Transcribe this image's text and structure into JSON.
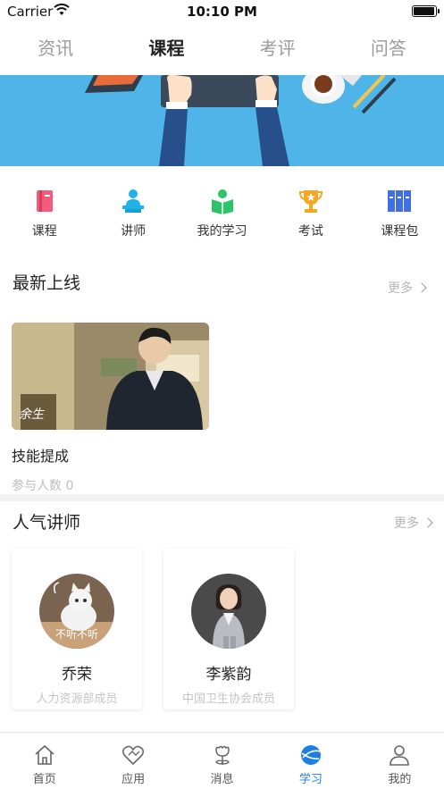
{
  "status_bar": {
    "carrier": "Carrier",
    "time": "10:10 PM"
  },
  "top_tabs": [
    {
      "label": "资讯",
      "active": false
    },
    {
      "label": "课程",
      "active": true
    },
    {
      "label": "考评",
      "active": false
    },
    {
      "label": "问答",
      "active": false
    }
  ],
  "quick_menu": [
    {
      "label": "课程",
      "icon": "book-icon",
      "color": "#f25c7a"
    },
    {
      "label": "讲师",
      "icon": "lecturer-icon",
      "color": "#1fb3e8"
    },
    {
      "label": "我的学习",
      "icon": "reading-icon",
      "color": "#2cc36b"
    },
    {
      "label": "考试",
      "icon": "trophy-icon",
      "color": "#f5a623"
    },
    {
      "label": "课程包",
      "icon": "package-icon",
      "color": "#3f6fe0"
    }
  ],
  "latest": {
    "title": "最新上线",
    "more": "更多",
    "course": {
      "name": "技能提成",
      "participants": "参与人数 0",
      "thumb_caption": "余生"
    }
  },
  "popular": {
    "title": "人气讲师",
    "more": "更多",
    "lecturers": [
      {
        "name": "乔荣",
        "role": "人力资源部成员",
        "avatar_text": "不听不听"
      },
      {
        "name": "李紫韵",
        "role": "中国卫生协会成员"
      }
    ]
  },
  "bottom_nav": [
    {
      "label": "首页",
      "icon": "home-icon",
      "active": false
    },
    {
      "label": "应用",
      "icon": "apps-icon",
      "active": false
    },
    {
      "label": "消息",
      "icon": "message-icon",
      "active": false
    },
    {
      "label": "学习",
      "icon": "study-icon",
      "active": true
    },
    {
      "label": "我的",
      "icon": "profile-icon",
      "active": false
    }
  ],
  "colors": {
    "accent": "#1f7fe0",
    "banner": "#4fb5e8"
  }
}
